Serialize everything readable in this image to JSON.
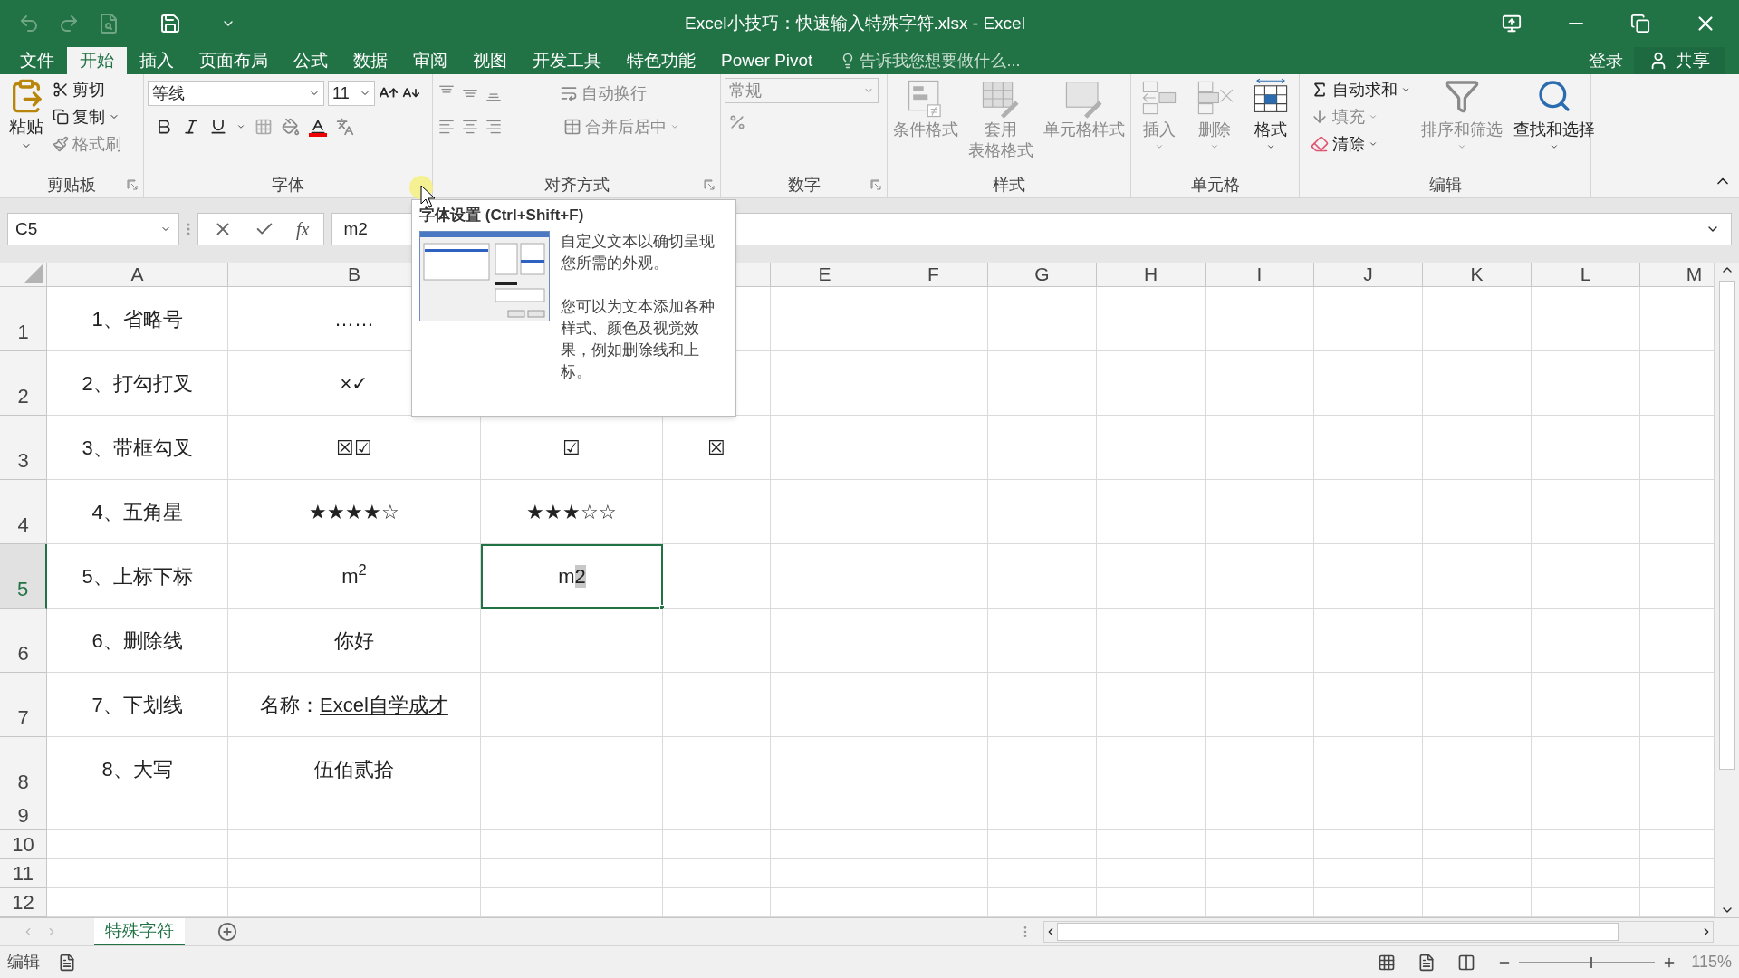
{
  "title_bar": {
    "title": "Excel小技巧：快速输入特殊字符.xlsx - Excel"
  },
  "menu_tabs": [
    {
      "label": "文件",
      "selected": false
    },
    {
      "label": "开始",
      "selected": true
    },
    {
      "label": "插入",
      "selected": false
    },
    {
      "label": "页面布局",
      "selected": false
    },
    {
      "label": "公式",
      "selected": false
    },
    {
      "label": "数据",
      "selected": false
    },
    {
      "label": "审阅",
      "selected": false
    },
    {
      "label": "视图",
      "selected": false
    },
    {
      "label": "开发工具",
      "selected": false
    },
    {
      "label": "特色功能",
      "selected": false
    },
    {
      "label": "Power Pivot",
      "selected": false
    }
  ],
  "tell_me": {
    "placeholder": "告诉我您想要做什么..."
  },
  "account": {
    "sign_in": "登录",
    "share": "共享"
  },
  "ribbon": {
    "clipboard": {
      "label": "剪贴板",
      "paste": "粘贴",
      "cut": "剪切",
      "copy": "复制",
      "format_painter": {
        "label": "格式刷",
        "disabled": true
      }
    },
    "font": {
      "label": "字体",
      "font_name": "等线",
      "font_size": "11"
    },
    "alignment": {
      "label": "对齐方式",
      "wrap_text": "自动换行",
      "merge": "合并后居中",
      "disabled": true
    },
    "number": {
      "label": "数字",
      "format": "常规",
      "disabled": true
    },
    "styles": {
      "label": "样式",
      "buttons": [
        {
          "lines": [
            "条件格式"
          ],
          "disabled": true
        },
        {
          "lines": [
            "套用",
            "表格格式"
          ],
          "disabled": true
        },
        {
          "lines": [
            "单元格样式"
          ],
          "disabled": true
        }
      ]
    },
    "cells": {
      "label": "单元格",
      "buttons": [
        {
          "label": "插入",
          "disabled": true
        },
        {
          "label": "删除",
          "disabled": true
        },
        {
          "label": "格式",
          "disabled": false
        }
      ]
    },
    "editing": {
      "label": "编辑",
      "small_buttons": [
        {
          "label": "自动求和",
          "disabled": false
        },
        {
          "label": "填充",
          "disabled": true
        },
        {
          "label": "清除",
          "disabled": false
        }
      ],
      "large_buttons": [
        {
          "label": "排序和筛选",
          "disabled": true
        },
        {
          "label": "查找和选择",
          "disabled": false
        }
      ]
    }
  },
  "formula_bar": {
    "name_box": "C5",
    "function_label": "fx",
    "formula": "m2"
  },
  "columns": [
    "A",
    "B",
    null,
    null,
    "E",
    "F",
    "G",
    "H",
    "I",
    "J",
    "K",
    "L",
    "M"
  ],
  "rows": [
    {
      "number": "1",
      "selected": false,
      "cells": [
        {
          "text": "1、省略号",
          "selected": false
        },
        {
          "text": "……",
          "selected": false
        }
      ]
    },
    {
      "number": "2",
      "selected": false,
      "cells": [
        {
          "text": "2、打勾打叉",
          "selected": false
        },
        {
          "text": "×✓",
          "selected": false
        }
      ]
    },
    {
      "number": "3",
      "selected": false,
      "cells": [
        {
          "text": "3、带框勾叉",
          "selected": false
        },
        {
          "text": "☒☑",
          "selected": false
        },
        {
          "text": "☑",
          "selected": false
        },
        {
          "text": "☒",
          "selected": false
        }
      ]
    },
    {
      "number": "4",
      "selected": false,
      "cells": [
        {
          "text": "4、五角星",
          "selected": false
        },
        {
          "text": "★★★★☆",
          "selected": false
        },
        {
          "text": "★★★☆☆",
          "selected": false
        },
        {
          "selected": false
        }
      ]
    },
    {
      "number": "5",
      "selected": true,
      "cells": [
        {
          "text": "5、上标下标",
          "selected": false
        },
        {
          "text": "m$^{2}$",
          "selected": false
        },
        {
          "parts": [
            {
              "text": "m",
              "highlighted": false
            },
            {
              "text": "2",
              "highlighted": true
            }
          ],
          "selected": true
        },
        {
          "selected": false
        }
      ]
    },
    {
      "number": "6",
      "selected": false,
      "cells": [
        {
          "text": "6、删除线",
          "selected": false
        },
        {
          "text": "你好",
          "selected": false
        }
      ]
    },
    {
      "number": "7",
      "selected": false,
      "cells": [
        {
          "text": "7、下划线",
          "selected": false
        },
        {
          "parts": [
            {
              "text": "名称：",
              "underline": false
            },
            {
              "text": "Excel自学成才",
              "underline": true
            }
          ],
          "selected": false
        }
      ]
    },
    {
      "number": "8",
      "selected": false,
      "cells": [
        {
          "text": "8、大写",
          "selected": false
        },
        {
          "text": "伍佰贰拾",
          "selected": false
        }
      ]
    },
    {
      "number": "9",
      "selected": false,
      "cells": []
    },
    {
      "number": "10",
      "selected": false,
      "cells": []
    },
    {
      "number": "11",
      "selected": false,
      "cells": []
    },
    {
      "number": "12",
      "selected": false,
      "cells": []
    }
  ],
  "tooltip": {
    "title": "字体设置 (Ctrl+Shift+F)",
    "paragraphs": [
      "自定义文本以确切呈现您所需的外观。",
      "您可以为文本添加各种样式、颜色及视觉效果，例如删除线和上标。"
    ]
  },
  "sheet_tabs": [
    {
      "label": "特殊字符",
      "selected": true
    }
  ],
  "status_bar": {
    "mode": "编辑",
    "zoom": {
      "reading": "115%",
      "level": 0.52
    }
  }
}
